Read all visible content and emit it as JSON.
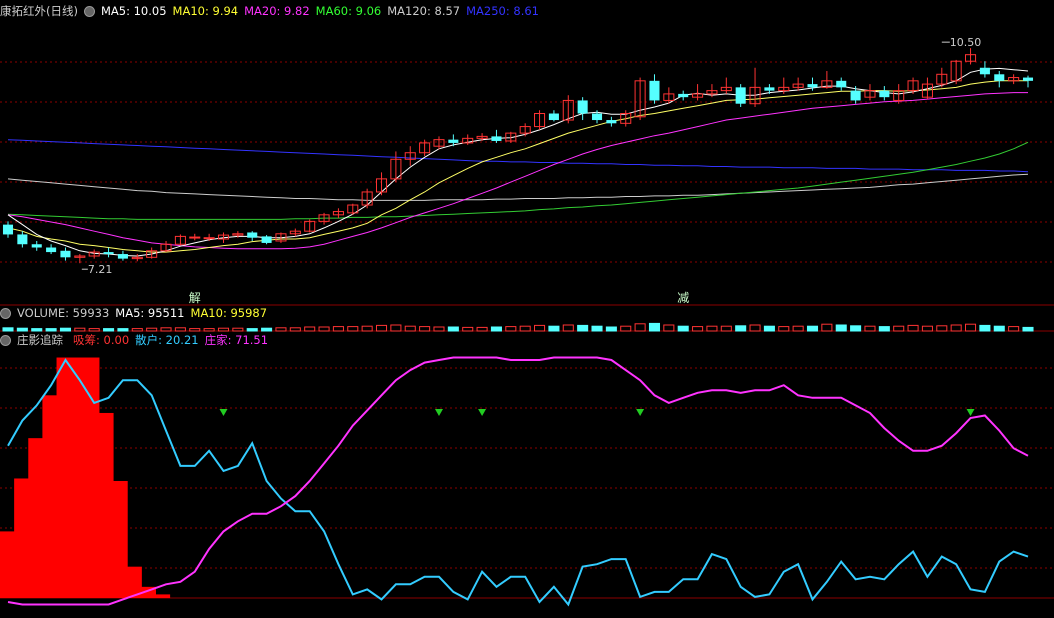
{
  "price_header": {
    "title": "康拓红外(日线)",
    "items": [
      {
        "text": "MA5: 10.05",
        "color": "#ffffff"
      },
      {
        "text": "MA10: 9.94",
        "color": "#ffff33"
      },
      {
        "text": "MA20: 9.82",
        "color": "#ff33ff"
      },
      {
        "text": "MA60: 9.06",
        "color": "#33ff33"
      },
      {
        "text": "MA120: 8.57",
        "color": "#cccccc"
      },
      {
        "text": "MA250: 8.61",
        "color": "#3333ff"
      }
    ]
  },
  "volume_header": {
    "items": [
      {
        "text": "VOLUME: 59933",
        "color": "#cccccc"
      },
      {
        "text": "MA5: 95511",
        "color": "#ffffff"
      },
      {
        "text": "MA10: 95987",
        "color": "#ffff33"
      }
    ]
  },
  "indicator_header": {
    "title": "庄影追踪",
    "items": [
      {
        "text": "吸筹: 0.00",
        "color": "#ff3333"
      },
      {
        "text": "散户: 20.21",
        "color": "#33ccff"
      },
      {
        "text": "庄家: 71.51",
        "color": "#ff33ff"
      }
    ]
  },
  "colors": {
    "up": "#ff3333",
    "down": "#55ffff",
    "ma5": "#ffffff",
    "ma10": "#ffff66",
    "ma20": "#ff33ff",
    "ma60": "#33cc33",
    "ma120": "#cccccc",
    "ma250": "#3333ff",
    "grid": "#8b0000"
  },
  "chart_data": [
    {
      "type": "candlestick",
      "title": "康拓红外(日线)",
      "ylim": [
        6.8,
        10.9
      ],
      "annotations": [
        {
          "label": "7.21",
          "index": 5,
          "value": 7.21,
          "kind": "low"
        },
        {
          "label": "10.50",
          "index": 65,
          "value": 10.5,
          "kind": "high"
        },
        {
          "label": "解",
          "index": 13
        },
        {
          "label": "减",
          "index": 47
        }
      ],
      "candles": [
        [
          7.8,
          7.65,
          7.85,
          7.6
        ],
        [
          7.65,
          7.5,
          7.7,
          7.45
        ],
        [
          7.5,
          7.45,
          7.55,
          7.4
        ],
        [
          7.45,
          7.38,
          7.5,
          7.35
        ],
        [
          7.4,
          7.3,
          7.45,
          7.25
        ],
        [
          7.3,
          7.32,
          7.35,
          7.21
        ],
        [
          7.32,
          7.38,
          7.42,
          7.28
        ],
        [
          7.38,
          7.35,
          7.45,
          7.3
        ],
        [
          7.35,
          7.28,
          7.4,
          7.25
        ],
        [
          7.28,
          7.3,
          7.35,
          7.24
        ],
        [
          7.3,
          7.4,
          7.45,
          7.28
        ],
        [
          7.4,
          7.5,
          7.55,
          7.38
        ],
        [
          7.5,
          7.62,
          7.65,
          7.48
        ],
        [
          7.6,
          7.61,
          7.66,
          7.56
        ],
        [
          7.6,
          7.6,
          7.66,
          7.55
        ],
        [
          7.58,
          7.64,
          7.68,
          7.52
        ],
        [
          7.64,
          7.66,
          7.7,
          7.6
        ],
        [
          7.68,
          7.6,
          7.7,
          7.55
        ],
        [
          7.62,
          7.52,
          7.64,
          7.5
        ],
        [
          7.55,
          7.66,
          7.68,
          7.52
        ],
        [
          7.66,
          7.7,
          7.74,
          7.62
        ],
        [
          7.7,
          7.85,
          7.88,
          7.68
        ],
        [
          7.85,
          7.95,
          7.98,
          7.8
        ],
        [
          7.95,
          8.0,
          8.05,
          7.9
        ],
        [
          7.98,
          8.1,
          8.12,
          7.95
        ],
        [
          8.1,
          8.3,
          8.35,
          8.05
        ],
        [
          8.3,
          8.5,
          8.6,
          8.25
        ],
        [
          8.5,
          8.8,
          8.92,
          8.45
        ],
        [
          8.8,
          8.9,
          9.0,
          8.7
        ],
        [
          8.9,
          9.05,
          9.1,
          8.85
        ],
        [
          9.0,
          9.1,
          9.15,
          8.95
        ],
        [
          9.1,
          9.05,
          9.18,
          9.0
        ],
        [
          9.05,
          9.12,
          9.18,
          9.02
        ],
        [
          9.12,
          9.15,
          9.2,
          9.08
        ],
        [
          9.15,
          9.08,
          9.25,
          9.05
        ],
        [
          9.08,
          9.2,
          9.22,
          9.05
        ],
        [
          9.2,
          9.3,
          9.35,
          9.15
        ],
        [
          9.3,
          9.5,
          9.55,
          9.25
        ],
        [
          9.5,
          9.4,
          9.55,
          9.38
        ],
        [
          9.4,
          9.7,
          9.78,
          9.35
        ],
        [
          9.7,
          9.5,
          9.75,
          9.4
        ],
        [
          9.5,
          9.4,
          9.55,
          9.35
        ],
        [
          9.4,
          9.35,
          9.45,
          9.3
        ],
        [
          9.35,
          9.5,
          9.55,
          9.3
        ],
        [
          9.45,
          10.0,
          10.05,
          9.4
        ],
        [
          10.0,
          9.7,
          10.1,
          9.65
        ],
        [
          9.7,
          9.8,
          9.9,
          9.65
        ],
        [
          9.8,
          9.75,
          9.85,
          9.7
        ],
        [
          9.75,
          9.8,
          9.95,
          9.7
        ],
        [
          9.8,
          9.85,
          9.95,
          9.75
        ],
        [
          9.85,
          9.9,
          10.05,
          9.8
        ],
        [
          9.9,
          9.65,
          9.95,
          9.6
        ],
        [
          9.65,
          9.9,
          10.2,
          9.6
        ],
        [
          9.9,
          9.85,
          9.95,
          9.8
        ],
        [
          9.85,
          9.9,
          10.05,
          9.8
        ],
        [
          9.9,
          9.95,
          10.05,
          9.85
        ],
        [
          9.95,
          9.9,
          10.05,
          9.85
        ],
        [
          9.9,
          10.0,
          10.15,
          9.88
        ],
        [
          10.0,
          9.9,
          10.05,
          9.85
        ],
        [
          9.85,
          9.7,
          9.92,
          9.65
        ],
        [
          9.75,
          9.85,
          9.95,
          9.7
        ],
        [
          9.85,
          9.75,
          9.92,
          9.7
        ],
        [
          9.7,
          9.85,
          9.95,
          9.65
        ],
        [
          9.85,
          10.0,
          10.05,
          9.8
        ],
        [
          9.75,
          9.95,
          10.05,
          9.72
        ],
        [
          9.95,
          10.1,
          10.2,
          9.9
        ],
        [
          10.0,
          10.3,
          10.32,
          9.95
        ],
        [
          10.3,
          10.4,
          10.5,
          10.25
        ],
        [
          10.2,
          10.1,
          10.3,
          10.05
        ],
        [
          10.1,
          10.0,
          10.15,
          9.9
        ],
        [
          10.0,
          10.05,
          10.1,
          9.95
        ],
        [
          10.05,
          10.0,
          10.08,
          9.9
        ]
      ],
      "ma": {
        "ma5": [
          7.95,
          7.8,
          7.65,
          7.55,
          7.48,
          7.4,
          7.36,
          7.35,
          7.33,
          7.32,
          7.35,
          7.4,
          7.47,
          7.52,
          7.57,
          7.6,
          7.62,
          7.62,
          7.6,
          7.6,
          7.62,
          7.66,
          7.75,
          7.85,
          7.96,
          8.1,
          8.3,
          8.5,
          8.68,
          8.83,
          8.96,
          9.02,
          9.06,
          9.1,
          9.12,
          9.13,
          9.18,
          9.25,
          9.33,
          9.42,
          9.5,
          9.52,
          9.49,
          9.49,
          9.55,
          9.6,
          9.66,
          9.78,
          9.81,
          9.78,
          9.8,
          9.78,
          9.78,
          9.82,
          9.84,
          9.86,
          9.89,
          9.92,
          9.92,
          9.88,
          9.85,
          9.82,
          9.8,
          9.83,
          9.88,
          9.93,
          10.0,
          10.13,
          10.18,
          10.19,
          10.17,
          10.15
        ],
        "ma10": [
          7.75,
          7.7,
          7.62,
          7.58,
          7.55,
          7.5,
          7.48,
          7.45,
          7.42,
          7.4,
          7.38,
          7.38,
          7.4,
          7.42,
          7.45,
          7.48,
          7.5,
          7.54,
          7.56,
          7.58,
          7.58,
          7.6,
          7.65,
          7.7,
          7.75,
          7.82,
          7.95,
          8.05,
          8.18,
          8.3,
          8.44,
          8.55,
          8.66,
          8.76,
          8.83,
          8.9,
          8.96,
          9.04,
          9.12,
          9.2,
          9.26,
          9.32,
          9.38,
          9.42,
          9.47,
          9.5,
          9.54,
          9.58,
          9.62,
          9.66,
          9.7,
          9.71,
          9.72,
          9.74,
          9.76,
          9.78,
          9.8,
          9.82,
          9.84,
          9.84,
          9.85,
          9.85,
          9.84,
          9.85,
          9.86,
          9.88,
          9.9,
          9.95,
          9.98,
          10.0,
          10.0,
          10.0
        ],
        "ma20": [
          7.95,
          7.92,
          7.88,
          7.84,
          7.8,
          7.75,
          7.7,
          7.65,
          7.6,
          7.56,
          7.52,
          7.5,
          7.48,
          7.46,
          7.45,
          7.44,
          7.43,
          7.43,
          7.43,
          7.43,
          7.44,
          7.46,
          7.5,
          7.56,
          7.62,
          7.68,
          7.75,
          7.83,
          7.91,
          7.98,
          8.05,
          8.12,
          8.2,
          8.28,
          8.36,
          8.45,
          8.54,
          8.63,
          8.72,
          8.8,
          8.88,
          8.95,
          9.01,
          9.06,
          9.11,
          9.16,
          9.2,
          9.25,
          9.3,
          9.35,
          9.4,
          9.43,
          9.46,
          9.49,
          9.52,
          9.55,
          9.58,
          9.6,
          9.62,
          9.64,
          9.66,
          9.68,
          9.69,
          9.7,
          9.72,
          9.74,
          9.76,
          9.78,
          9.8,
          9.81,
          9.82,
          9.82
        ],
        "ma60": [
          7.96,
          7.95,
          7.94,
          7.93,
          7.92,
          7.91,
          7.9,
          7.89,
          7.89,
          7.88,
          7.88,
          7.88,
          7.88,
          7.88,
          7.88,
          7.88,
          7.88,
          7.88,
          7.88,
          7.88,
          7.89,
          7.89,
          7.9,
          7.9,
          7.91,
          7.91,
          7.92,
          7.92,
          7.93,
          7.94,
          7.95,
          7.96,
          7.97,
          7.98,
          7.99,
          8.0,
          8.01,
          8.03,
          8.04,
          8.06,
          8.07,
          8.09,
          8.1,
          8.12,
          8.14,
          8.16,
          8.18,
          8.2,
          8.22,
          8.24,
          8.26,
          8.28,
          8.3,
          8.32,
          8.34,
          8.36,
          8.39,
          8.42,
          8.45,
          8.48,
          8.51,
          8.54,
          8.57,
          8.6,
          8.64,
          8.68,
          8.72,
          8.77,
          8.82,
          8.88,
          8.96,
          9.06
        ],
        "ma120": [
          8.5,
          8.48,
          8.46,
          8.44,
          8.42,
          8.4,
          8.38,
          8.36,
          8.34,
          8.32,
          8.31,
          8.29,
          8.28,
          8.27,
          8.26,
          8.25,
          8.24,
          8.23,
          8.22,
          8.21,
          8.2,
          8.2,
          8.19,
          8.18,
          8.18,
          8.17,
          8.17,
          8.17,
          8.17,
          8.17,
          8.18,
          8.18,
          8.18,
          8.18,
          8.19,
          8.19,
          8.2,
          8.2,
          8.2,
          8.21,
          8.21,
          8.22,
          8.22,
          8.23,
          8.23,
          8.24,
          8.24,
          8.25,
          8.25,
          8.26,
          8.27,
          8.28,
          8.29,
          8.3,
          8.31,
          8.32,
          8.33,
          8.34,
          8.35,
          8.36,
          8.37,
          8.39,
          8.41,
          8.42,
          8.44,
          8.46,
          8.48,
          8.5,
          8.52,
          8.54,
          8.56,
          8.57
        ],
        "ma250": [
          9.1,
          9.09,
          9.08,
          9.07,
          9.06,
          9.05,
          9.04,
          9.03,
          9.02,
          9.01,
          9.0,
          8.99,
          8.98,
          8.97,
          8.96,
          8.95,
          8.94,
          8.93,
          8.92,
          8.91,
          8.9,
          8.89,
          8.88,
          8.87,
          8.86,
          8.85,
          8.84,
          8.83,
          8.82,
          8.81,
          8.8,
          8.79,
          8.78,
          8.77,
          8.77,
          8.76,
          8.76,
          8.75,
          8.75,
          8.74,
          8.74,
          8.73,
          8.73,
          8.72,
          8.72,
          8.71,
          8.71,
          8.7,
          8.7,
          8.69,
          8.69,
          8.68,
          8.68,
          8.68,
          8.67,
          8.67,
          8.67,
          8.66,
          8.66,
          8.66,
          8.65,
          8.65,
          8.65,
          8.64,
          8.64,
          8.64,
          8.63,
          8.63,
          8.63,
          8.62,
          8.62,
          8.61
        ]
      }
    },
    {
      "type": "bar",
      "title": "VOLUME",
      "volume_rel": [
        0.4,
        0.35,
        0.3,
        0.3,
        0.35,
        0.35,
        0.3,
        0.3,
        0.3,
        0.3,
        0.35,
        0.4,
        0.4,
        0.3,
        0.3,
        0.35,
        0.35,
        0.3,
        0.35,
        0.4,
        0.4,
        0.5,
        0.5,
        0.55,
        0.55,
        0.6,
        0.7,
        0.75,
        0.6,
        0.55,
        0.5,
        0.5,
        0.45,
        0.45,
        0.5,
        0.55,
        0.6,
        0.7,
        0.6,
        0.75,
        0.7,
        0.6,
        0.5,
        0.6,
        0.9,
        0.95,
        0.75,
        0.6,
        0.55,
        0.6,
        0.6,
        0.65,
        0.75,
        0.6,
        0.55,
        0.6,
        0.6,
        0.85,
        0.75,
        0.65,
        0.6,
        0.55,
        0.6,
        0.7,
        0.6,
        0.65,
        0.75,
        0.85,
        0.7,
        0.6,
        0.55,
        0.45
      ]
    },
    {
      "type": "line",
      "title": "庄影追踪",
      "ylim": [
        0,
        100
      ],
      "series": [
        {
          "name": "散户",
          "color": "#33ccff",
          "values": [
            64,
            74,
            80,
            88,
            98,
            90,
            81,
            83,
            90,
            90,
            84,
            70,
            56,
            56,
            62,
            54,
            56,
            65,
            50,
            43,
            38,
            38,
            30,
            17,
            5,
            7,
            3,
            9,
            9,
            12,
            12,
            6,
            3,
            14,
            8,
            12,
            12,
            2,
            8,
            1,
            16,
            17,
            19,
            19,
            4,
            6,
            6,
            11,
            11,
            21,
            19,
            8,
            4,
            5,
            14,
            17,
            3,
            10,
            18,
            11,
            12,
            11,
            17,
            22,
            12,
            20,
            17,
            7,
            6,
            18,
            22,
            20
          ]
        },
        {
          "name": "庄家",
          "color": "#ff33ff",
          "values": [
            2,
            1,
            1,
            1,
            1,
            1,
            1,
            1,
            3,
            5,
            7,
            9,
            10,
            14,
            23,
            30,
            34,
            37,
            37,
            40,
            44,
            50,
            57,
            64,
            72,
            78,
            84,
            90,
            94,
            97,
            98,
            99,
            99,
            99,
            99,
            98,
            98,
            98,
            99,
            99,
            99,
            99,
            98,
            94,
            90,
            84,
            81,
            83,
            85,
            86,
            86,
            85,
            86,
            86,
            88,
            84,
            83,
            83,
            83,
            80,
            77,
            71,
            66,
            62,
            62,
            64,
            69,
            75,
            76,
            70,
            63,
            60
          ]
        },
        {
          "name": "吸筹",
          "color": "#ff0000",
          "values": [
            30,
            51,
            67,
            84,
            99,
            99,
            99,
            77,
            50,
            16,
            8,
            5,
            2,
            2,
            1,
            1,
            1,
            0,
            0,
            0,
            0,
            0,
            0,
            0,
            0,
            0,
            0,
            0,
            0,
            0,
            0,
            0,
            0,
            0,
            0,
            0,
            0,
            0,
            0,
            0,
            0,
            0,
            0,
            0,
            0,
            0,
            0,
            0,
            0,
            0,
            0,
            0,
            0,
            0,
            0,
            0,
            0,
            0,
            0,
            0,
            0,
            0,
            0,
            0,
            0,
            0,
            0,
            0,
            0,
            0,
            0,
            0,
            0,
            0
          ]
        }
      ],
      "signals": [
        15,
        30,
        33,
        44,
        67
      ]
    }
  ]
}
